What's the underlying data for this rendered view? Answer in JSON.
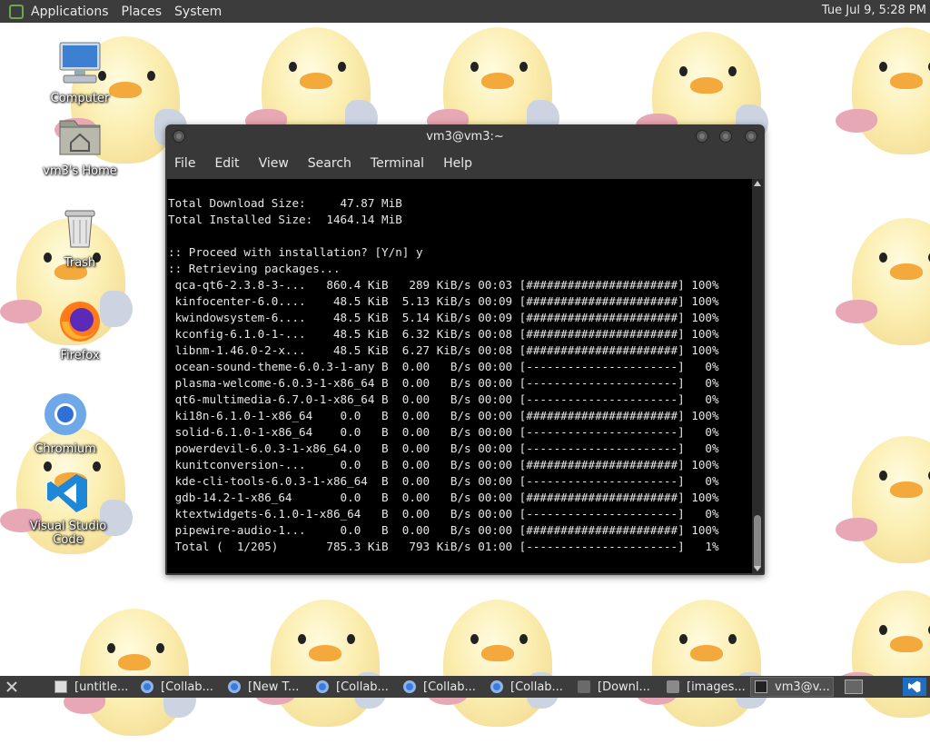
{
  "top_panel": {
    "menus": [
      "Applications",
      "Places",
      "System"
    ],
    "clock": "Tue Jul  9,  5:28 PM"
  },
  "desktop_icons": [
    {
      "label": "Computer",
      "icon": "computer-icon"
    },
    {
      "label": "vm3's Home",
      "icon": "home-folder-icon"
    },
    {
      "label": "Trash",
      "icon": "trash-icon"
    },
    {
      "label": "Firefox",
      "icon": "firefox-icon"
    },
    {
      "label": "Chromium",
      "icon": "chromium-icon"
    },
    {
      "label": "Visual Studio Code",
      "icon": "vscode-icon"
    }
  ],
  "terminal": {
    "title": "vm3@vm3:~",
    "menu": [
      "File",
      "Edit",
      "View",
      "Search",
      "Terminal",
      "Help"
    ],
    "lines": [
      "Total Download Size:     47.87 MiB",
      "Total Installed Size:  1464.14 MiB",
      "",
      ":: Proceed with installation? [Y/n] y",
      ":: Retrieving packages...",
      " qca-qt6-2.3.8-3-...   860.4 KiB   289 KiB/s 00:03 [######################] 100%",
      " kinfocenter-6.0....    48.5 KiB  5.13 KiB/s 00:09 [######################] 100%",
      " kwindowsystem-6....    48.5 KiB  5.14 KiB/s 00:09 [######################] 100%",
      " kconfig-6.1.0-1-...    48.5 KiB  6.32 KiB/s 00:08 [######################] 100%",
      " libnm-1.46.0-2-x...    48.5 KiB  6.27 KiB/s 00:08 [######################] 100%",
      " ocean-sound-theme-6.0.3-1-any B  0.00   B/s 00:00 [----------------------]   0%",
      " plasma-welcome-6.0.3-1-x86_64 B  0.00   B/s 00:00 [----------------------]   0%",
      " qt6-multimedia-6.7.0-1-x86_64 B  0.00   B/s 00:00 [----------------------]   0%",
      " ki18n-6.1.0-1-x86_64    0.0   B  0.00   B/s 00:00 [######################] 100%",
      " solid-6.1.0-1-x86_64    0.0   B  0.00   B/s 00:00 [----------------------]   0%",
      " powerdevil-6.0.3-1-x86_64.0   B  0.00   B/s 00:00 [----------------------]   0%",
      " kunitconversion-...     0.0   B  0.00   B/s 00:00 [######################] 100%",
      " kde-cli-tools-6.0.3-1-x86_64  B  0.00   B/s 00:00 [----------------------]   0%",
      " gdb-14.2-1-x86_64       0.0   B  0.00   B/s 00:00 [######################] 100%",
      " ktextwidgets-6.1.0-1-x86_64   B  0.00   B/s 00:00 [----------------------]   0%",
      " pipewire-audio-1...     0.0   B  0.00   B/s 00:00 [######################] 100%",
      " Total (  1/205)       785.3 KiB   793 KiB/s 01:00 [----------------------]   1%"
    ]
  },
  "taskbar": {
    "tasks": [
      {
        "label": "[untitle...",
        "icon": "document-icon"
      },
      {
        "label": "[Collab...",
        "icon": "chromium-icon"
      },
      {
        "label": "[New T...",
        "icon": "chromium-icon"
      },
      {
        "label": "[Collab...",
        "icon": "chromium-icon"
      },
      {
        "label": "[Collab...",
        "icon": "chromium-icon"
      },
      {
        "label": "[Collab...",
        "icon": "chromium-icon"
      },
      {
        "label": "[Downl...",
        "icon": "folder-icon"
      },
      {
        "label": "[images...",
        "icon": "image-viewer-icon"
      },
      {
        "label": "vm3@v...",
        "icon": "terminal-icon"
      }
    ]
  },
  "colors": {
    "panel_bg": "#3c3c3c",
    "terminal_bg": "#000000",
    "terminal_fg": "#e6e6e6",
    "wallpaper_chick": "#fbeeb0"
  }
}
